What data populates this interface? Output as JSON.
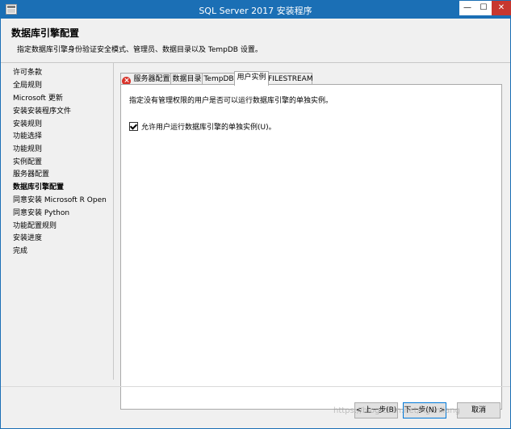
{
  "window": {
    "title": "SQL Server 2017 安装程序",
    "controls": {
      "minimize": "—",
      "maximize": "☐",
      "close": "✕"
    }
  },
  "header": {
    "title": "数据库引擎配置",
    "description": "指定数据库引擎身份验证安全模式、管理员、数据目录以及 TempDB 设置。"
  },
  "nav": {
    "items": [
      "许可条款",
      "全局规则",
      "Microsoft 更新",
      "安装安装程序文件",
      "安装规则",
      "功能选择",
      "功能规则",
      "实例配置",
      "服务器配置",
      "数据库引擎配置",
      "同意安装 Microsoft R Open",
      "同意安装 Python",
      "功能配置规则",
      "安装进度",
      "完成"
    ],
    "active_index": 9
  },
  "tabs": [
    {
      "label": "服务器配置",
      "error": true
    },
    {
      "label": "数据目录"
    },
    {
      "label": "TempDB"
    },
    {
      "label": "用户实例",
      "selected": true
    },
    {
      "label": "FILESTREAM"
    }
  ],
  "panel": {
    "description": "指定没有管理权限的用户是否可以运行数据库引擎的单独实例。",
    "checkbox_label": "允许用户运行数据库引擎的单独实例(U)。",
    "checkbox_checked": true
  },
  "buttons": {
    "back": "< 上一步(B)",
    "next": "下一步(N) >",
    "cancel": "取消"
  },
  "watermark": "https://blog.csdn.net/Aganliang",
  "colors": {
    "titlebar": "#1b6fb5",
    "close": "#c7372f",
    "error": "#d9342b"
  }
}
